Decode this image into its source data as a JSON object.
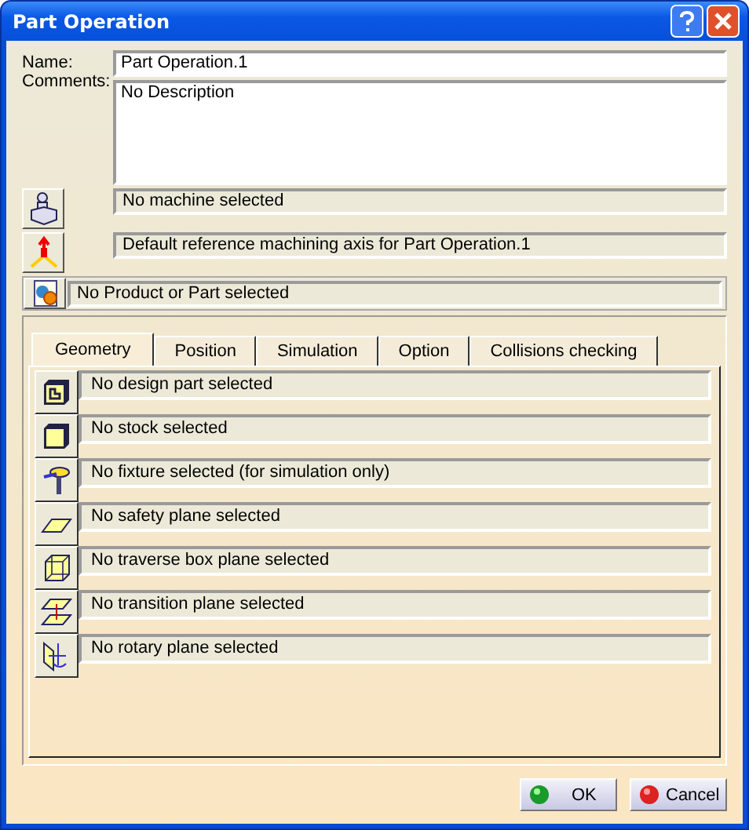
{
  "window": {
    "title": "Part Operation"
  },
  "name_label": "Name:",
  "name_value": "Part Operation.1",
  "comments_label": "Comments:",
  "comments_value": "No Description",
  "machine": {
    "text": "No machine selected"
  },
  "axis": {
    "text": "Default reference machining axis for Part Operation.1"
  },
  "product": {
    "text": "No Product or Part selected"
  },
  "tabs": [
    {
      "label": "Geometry",
      "selected": true
    },
    {
      "label": "Position",
      "selected": false
    },
    {
      "label": "Simulation",
      "selected": false
    },
    {
      "label": "Option",
      "selected": false
    },
    {
      "label": "Collisions checking",
      "selected": false
    }
  ],
  "geometry_rows": [
    {
      "kind": "design",
      "text": "No design part selected"
    },
    {
      "kind": "stock",
      "text": "No stock selected"
    },
    {
      "kind": "fixture",
      "text": "No fixture selected (for simulation only)"
    },
    {
      "kind": "safety",
      "text": "No safety plane selected"
    },
    {
      "kind": "traverse",
      "text": "No traverse box plane selected"
    },
    {
      "kind": "transition",
      "text": "No transition plane selected"
    },
    {
      "kind": "rotary",
      "text": "No rotary plane selected"
    }
  ],
  "buttons": [
    {
      "kind": "ok",
      "label": "OK"
    },
    {
      "kind": "cancel",
      "label": "Cancel"
    }
  ]
}
